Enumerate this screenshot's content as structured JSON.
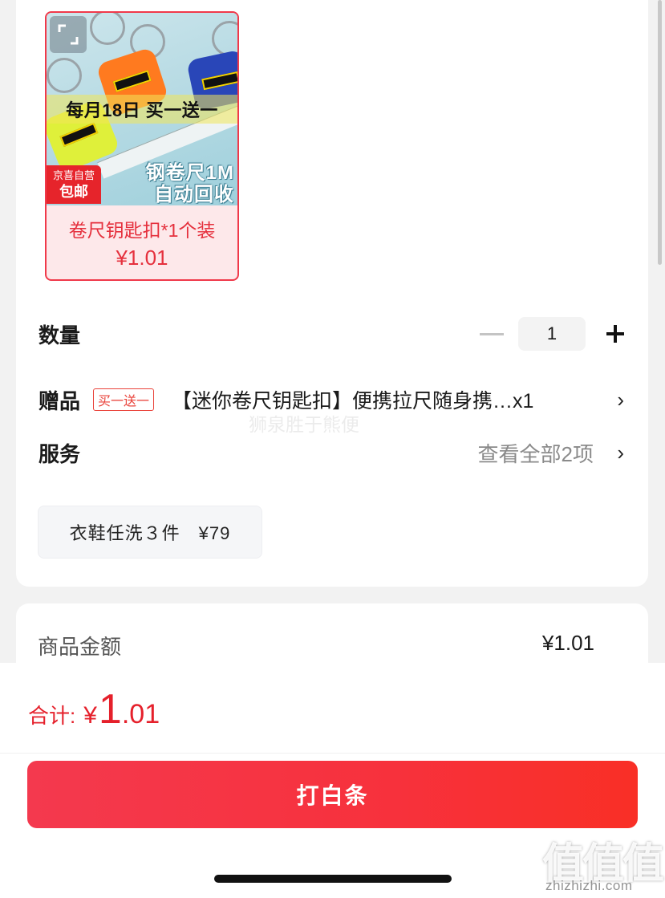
{
  "product": {
    "image_promo": "每月18日 买一送一",
    "image_caption_line1": "钢卷尺1M",
    "image_caption_line2": "自动回收",
    "badge_top": "京喜自营",
    "badge_bottom": "包邮",
    "name": "卷尺钥匙扣*1个装",
    "price": "¥1.01"
  },
  "quantity": {
    "label": "数量",
    "value": "1"
  },
  "gift": {
    "label": "赠品",
    "tag": "买一送一",
    "text": "【迷你卷尺钥匙扣】便携拉尺随身携…x1"
  },
  "service": {
    "label": "服务",
    "view_all": "查看全部2项",
    "chip": "衣鞋任洗３件　¥79"
  },
  "amount": {
    "label": "商品金额",
    "value": "¥1.01"
  },
  "total": {
    "label": "合计:",
    "symbol": "¥",
    "integer": "1",
    "decimal": ".01"
  },
  "pay_button": "打白条",
  "watermark": {
    "overlay": "狮泉胜于熊便",
    "logo": "值值值",
    "url": "zhizhizhi.com"
  },
  "colors": {
    "accent": "#e5202b",
    "button_start": "#f4394e",
    "button_end": "#f92f26"
  },
  "icons": [
    "expand-icon",
    "minus-icon",
    "plus-icon",
    "chevron-right-icon"
  ]
}
